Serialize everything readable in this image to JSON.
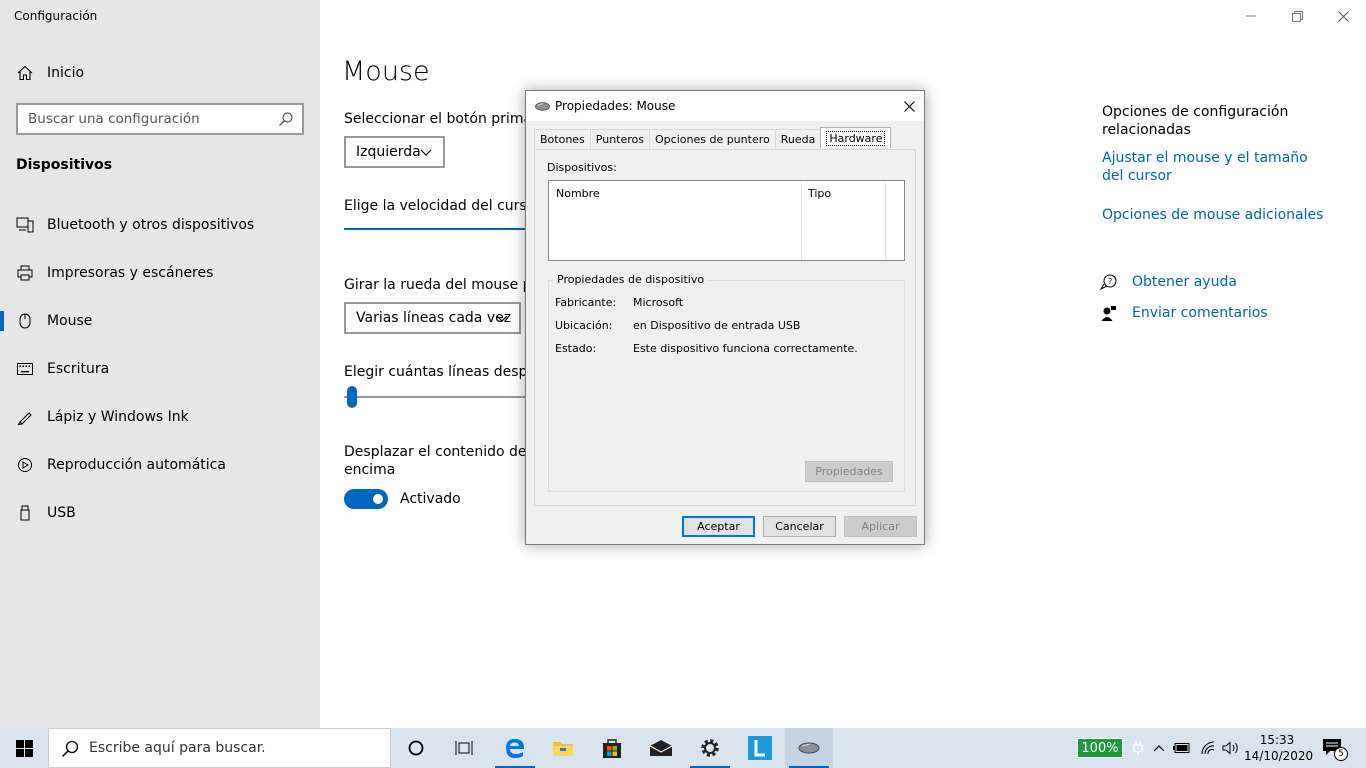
{
  "app": {
    "title": "Configuración",
    "home_label": "Inicio",
    "search_placeholder": "Buscar una configuración",
    "section_title": "Dispositivos",
    "nav_items": [
      {
        "label": "Bluetooth y otros dispositivos",
        "icon": "bluetooth-devices-icon"
      },
      {
        "label": "Impresoras y escáneres",
        "icon": "printer-icon"
      },
      {
        "label": "Mouse",
        "icon": "mouse-icon",
        "selected": true
      },
      {
        "label": "Escritura",
        "icon": "keyboard-icon"
      },
      {
        "label": "Lápiz y Windows Ink",
        "icon": "pen-icon"
      },
      {
        "label": "Reproducción automática",
        "icon": "autoplay-icon"
      },
      {
        "label": "USB",
        "icon": "usb-icon"
      }
    ]
  },
  "main": {
    "title": "Mouse",
    "primary_button_label": "Seleccionar el botón primario",
    "primary_button_value": "Izquierda",
    "cursor_speed_label": "Elige la velocidad del cursor",
    "wheel_label": "Girar la rueda del mouse para",
    "wheel_value": "Varias líneas cada vez",
    "lines_label": "Elegir cuántas líneas desplaza",
    "lines_slider_value": 0.05,
    "scroll_inactive_label_1": "Desplazar el contenido de Wi",
    "scroll_inactive_label_2": "encima",
    "toggle_state": "Activado"
  },
  "related": {
    "title": "Opciones de configuración relacionadas",
    "links": [
      "Ajustar el mouse y el tamaño del cursor",
      "Opciones de mouse adicionales"
    ],
    "help": "Obtener ayuda",
    "feedback": "Enviar comentarios"
  },
  "dialog": {
    "title": "Propiedades: Mouse",
    "tabs": [
      "Botones",
      "Punteros",
      "Opciones de puntero",
      "Rueda",
      "Hardware"
    ],
    "active_tab": "Hardware",
    "devices_label": "Dispositivos:",
    "columns": [
      "Nombre",
      "Tipo"
    ],
    "group_title": "Propiedades de dispositivo",
    "properties": [
      {
        "key": "Fabricante:",
        "value": "Microsoft"
      },
      {
        "key": "Ubicación:",
        "value": "en Dispositivo de entrada USB"
      },
      {
        "key": "Estado:",
        "value": "Este dispositivo funciona correctamente."
      }
    ],
    "properties_button": "Propiedades",
    "ok": "Aceptar",
    "cancel": "Cancelar",
    "apply": "Aplicar"
  },
  "taskbar": {
    "search_placeholder": "Escribe aquí para buscar.",
    "battery": "100%",
    "time": "15:33",
    "date": "14/10/2020",
    "notification_count": "5"
  },
  "colors": {
    "accent": "#0067c0",
    "link": "#0063b1",
    "sidebar_bg": "#e6e6e6",
    "taskbar_bg": "#dae4ee",
    "battery_bg": "#1d9b3b"
  }
}
